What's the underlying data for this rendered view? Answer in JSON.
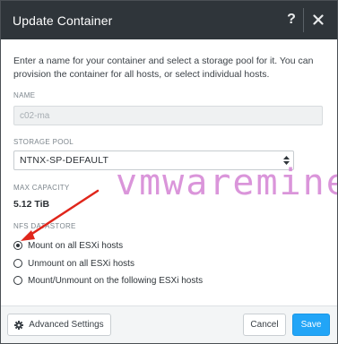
{
  "dialog": {
    "title": "Update Container",
    "help_glyph": "?",
    "intro": "Enter a name for your container and select a storage pool for it. You can provision the container for all hosts, or select individual hosts."
  },
  "name": {
    "label": "NAME",
    "value": "c02-ma"
  },
  "storage_pool": {
    "label": "STORAGE POOL",
    "selected": "NTNX-SP-DEFAULT"
  },
  "max_capacity": {
    "label": "MAX CAPACITY",
    "value": "5.12 TiB"
  },
  "nfs_datastore": {
    "label": "NFS DATASTORE",
    "options": [
      {
        "label": "Mount on all ESXi hosts",
        "selected": true
      },
      {
        "label": "Unmount on all ESXi hosts",
        "selected": false
      },
      {
        "label": "Mount/Unmount on the following ESXi hosts",
        "selected": false
      }
    ]
  },
  "footer": {
    "advanced_label": "Advanced Settings",
    "cancel_label": "Cancel",
    "save_label": "Save"
  },
  "watermark": "vmwaremine.",
  "colors": {
    "header_bg": "#2f353a",
    "save_bg": "#22a5f7",
    "watermark": "#d483d4",
    "arrow": "#e0261b"
  },
  "icons": [
    "help-icon",
    "close-icon",
    "select-caret-icon",
    "gear-icon",
    "annotation-arrow"
  ]
}
